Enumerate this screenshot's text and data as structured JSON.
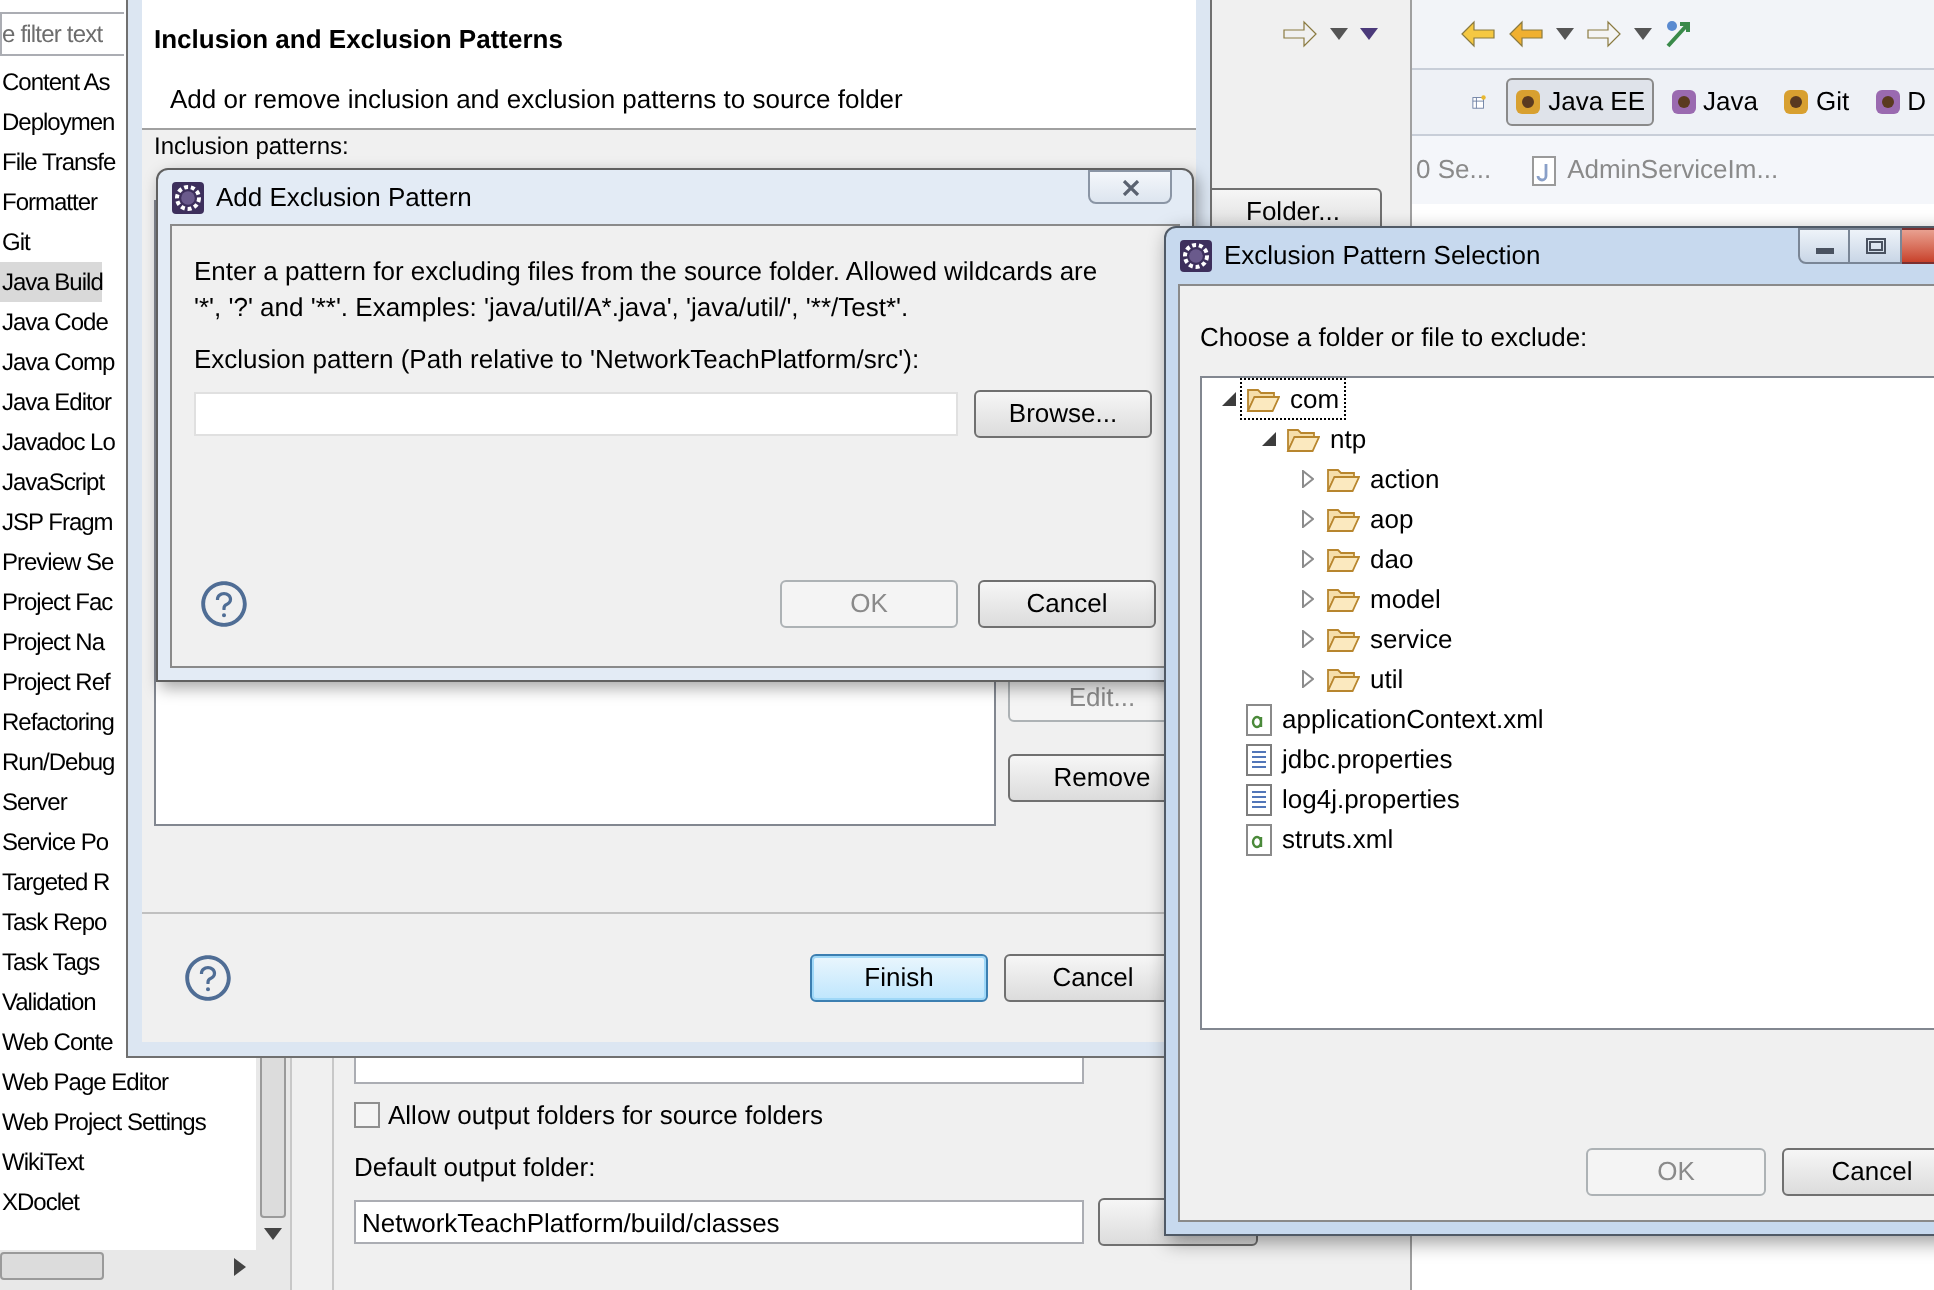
{
  "preferences": {
    "filter": {
      "placeholder": "e filter text"
    },
    "categories": [
      {
        "label": "Content As",
        "selected": false
      },
      {
        "label": "Deploymen",
        "selected": false
      },
      {
        "label": "File Transfe",
        "selected": false
      },
      {
        "label": "Formatter",
        "selected": false
      },
      {
        "label": "Git",
        "selected": false
      },
      {
        "label": "Java Build",
        "selected": true
      },
      {
        "label": "Java Code",
        "selected": false
      },
      {
        "label": "Java Comp",
        "selected": false
      },
      {
        "label": "Java Editor",
        "selected": false
      },
      {
        "label": "Javadoc Lo",
        "selected": false
      },
      {
        "label": "JavaScript",
        "selected": false
      },
      {
        "label": "JSP Fragm",
        "selected": false
      },
      {
        "label": "Preview Se",
        "selected": false
      },
      {
        "label": "Project Fac",
        "selected": false
      },
      {
        "label": "Project Na",
        "selected": false
      },
      {
        "label": "Project Ref",
        "selected": false
      },
      {
        "label": "Refactoring",
        "selected": false
      },
      {
        "label": "Run/Debug",
        "selected": false
      },
      {
        "label": "Server",
        "selected": false
      },
      {
        "label": "Service Po",
        "selected": false
      },
      {
        "label": "Targeted R",
        "selected": false
      },
      {
        "label": "Task Repo",
        "selected": false
      },
      {
        "label": "Task Tags",
        "selected": false
      },
      {
        "label": "Validation",
        "selected": false
      },
      {
        "label": "Web Conte",
        "selected": false
      },
      {
        "label": "Web Page Editor",
        "selected": false
      },
      {
        "label": "Web Project Settings",
        "selected": false
      },
      {
        "label": "WikiText",
        "selected": false
      },
      {
        "label": "XDoclet",
        "selected": false
      }
    ],
    "folder_button": "Folder...",
    "allow_output_folders": {
      "label": "Allow output folders for source folders",
      "checked": false
    },
    "default_output_folder": {
      "label": "Default output folder:",
      "value": "NetworkTeachPlatform/build/classes"
    }
  },
  "workbench": {
    "perspectives": [
      {
        "label": "Java EE",
        "selected": true
      },
      {
        "label": "Java",
        "selected": false
      },
      {
        "label": "Git",
        "selected": false
      },
      {
        "label": "D",
        "selected": false
      }
    ],
    "editor_tabs": [
      {
        "label": "0 Se..."
      },
      {
        "label": "AdminServiceIm..."
      }
    ]
  },
  "inclusion_dialog": {
    "title": "Inclusion and Exclusion Patterns",
    "description": "Add or remove inclusion and exclusion patterns to source folder",
    "inclusion_label": "Inclusion patterns:",
    "side_buttons": [
      {
        "label": "Edit...",
        "disabled": true
      },
      {
        "label": "Remove",
        "disabled": false
      }
    ],
    "buttons": [
      {
        "label": "Finish",
        "default": true,
        "disabled": false
      },
      {
        "label": "Cancel",
        "default": false,
        "disabled": false
      }
    ]
  },
  "add_exclusion_dialog": {
    "title": "Add Exclusion Pattern",
    "description": "Enter a pattern for excluding files from the source folder. Allowed wildcards are '*', '?' and '**'. Examples: 'java/util/A*.java', 'java/util/', '**/Test*'.",
    "field_label": "Exclusion pattern (Path relative to 'NetworkTeachPlatform/src'):",
    "browse": "Browse...",
    "buttons": [
      {
        "label": "OK",
        "default": false,
        "disabled": true
      },
      {
        "label": "Cancel",
        "default": false,
        "disabled": false
      }
    ]
  },
  "selection_dialog": {
    "title": "Exclusion Pattern Selection",
    "prompt": "Choose a folder or file to exclude:",
    "tree": [
      {
        "label": "com",
        "kind": "folder",
        "expanded": true,
        "focused": true,
        "children": [
          {
            "label": "ntp",
            "kind": "folder",
            "expanded": true,
            "focused": false,
            "children": [
              {
                "label": "action",
                "kind": "folder",
                "expanded": false,
                "focused": false
              },
              {
                "label": "aop",
                "kind": "folder",
                "expanded": false,
                "focused": false
              },
              {
                "label": "dao",
                "kind": "folder",
                "expanded": false,
                "focused": false
              },
              {
                "label": "model",
                "kind": "folder",
                "expanded": false,
                "focused": false
              },
              {
                "label": "service",
                "kind": "folder",
                "expanded": false,
                "focused": false
              },
              {
                "label": "util",
                "kind": "folder",
                "expanded": false,
                "focused": false
              }
            ]
          }
        ]
      },
      {
        "label": "applicationContext.xml",
        "kind": "xml",
        "focused": false
      },
      {
        "label": "jdbc.properties",
        "kind": "properties",
        "focused": false
      },
      {
        "label": "log4j.properties",
        "kind": "properties",
        "focused": false
      },
      {
        "label": "struts.xml",
        "kind": "xml",
        "focused": false
      }
    ],
    "buttons": [
      {
        "label": "OK",
        "default": false,
        "disabled": true
      },
      {
        "label": "Cancel",
        "default": false,
        "disabled": false
      }
    ]
  }
}
